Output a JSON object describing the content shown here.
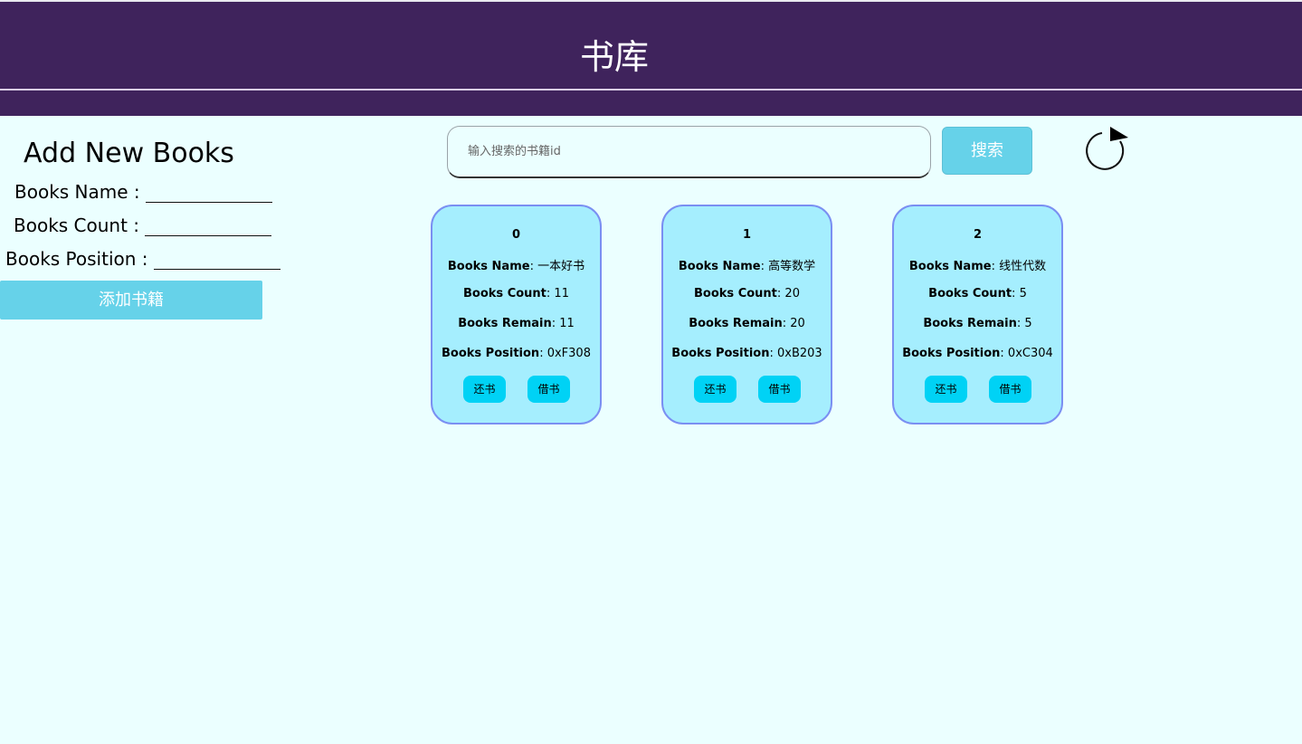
{
  "header": {
    "title": "书库"
  },
  "add_form": {
    "title": "Add New Books",
    "name_label": "Books Name :",
    "count_label": "Books Count :",
    "position_label": "Books Position :",
    "submit_label": "添加书籍"
  },
  "search": {
    "placeholder": "输入搜索的书籍id",
    "button_label": "搜索"
  },
  "books": [
    {
      "id": "0",
      "name_label": "Books Name",
      "name": "一本好书",
      "count_label": "Books Count",
      "count": "11",
      "remain_label": "Books Remain",
      "remain": "11",
      "position_label": "Books Position",
      "position": "0xF308",
      "return_label": "还书",
      "borrow_label": "借书"
    },
    {
      "id": "1",
      "name_label": "Books Name",
      "name": "高等数学",
      "count_label": "Books Count",
      "count": "20",
      "remain_label": "Books Remain",
      "remain": "20",
      "position_label": "Books Position",
      "position": "0xB203",
      "return_label": "还书",
      "borrow_label": "借书"
    },
    {
      "id": "2",
      "name_label": "Books Name",
      "name": "线性代数",
      "count_label": "Books Count",
      "count": "5",
      "remain_label": "Books Remain",
      "remain": "5",
      "position_label": "Books Position",
      "position": "0xC304",
      "return_label": "还书",
      "borrow_label": "借书"
    }
  ],
  "icons": {
    "refresh": "refresh-icon"
  },
  "colors": {
    "header_bg": "#3f235c",
    "page_bg": "#ebffff",
    "accent_button": "#66d2e9",
    "card_bg": "#a5eefe",
    "card_border": "#7a8ff2",
    "card_button": "#00d2f5"
  }
}
